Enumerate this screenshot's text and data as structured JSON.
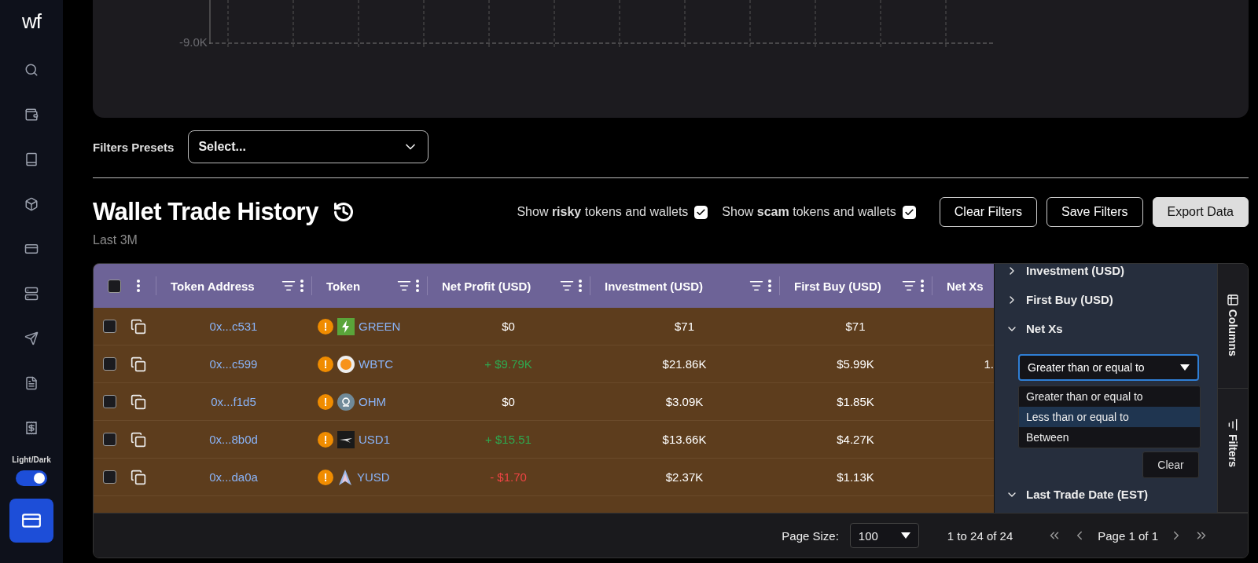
{
  "sidebar": {
    "logo": "wf",
    "items": [
      {
        "kind": "search",
        "selected": false
      },
      {
        "kind": "wallet",
        "selected": false
      },
      {
        "kind": "book",
        "selected": false
      },
      {
        "kind": "cube",
        "selected": false
      },
      {
        "kind": "card",
        "selected": false
      },
      {
        "kind": "server",
        "selected": false
      },
      {
        "kind": "send",
        "selected": false
      },
      {
        "kind": "file",
        "selected": false
      },
      {
        "kind": "receipt",
        "selected": false
      }
    ],
    "theme_toggle": {
      "label": "Light/Dark",
      "on": true
    },
    "bottom_item": {
      "kind": "card",
      "selected": true
    }
  },
  "chart": {
    "tick_label": "-9.0K"
  },
  "filters_presets": {
    "label": "Filters Presets",
    "placeholder": "Select..."
  },
  "header": {
    "title": "Wallet Trade History",
    "subtitle": "Last 3M"
  },
  "toggles": [
    {
      "label": "Show **risky** tokens and wallets",
      "checked": true
    },
    {
      "label": "Show **scam** tokens and wallets",
      "checked": true
    }
  ],
  "buttons": [
    {
      "label": "Clear Filters",
      "kind": "outline"
    },
    {
      "label": "Save Filters",
      "kind": "outline"
    },
    {
      "label": "Export Data",
      "kind": "solid"
    }
  ],
  "table": {
    "select_all": {
      "checked": false
    },
    "columns": [
      "Token Address",
      "Token",
      "Net Profit (USD)",
      "Investment (USD)",
      "First Buy (USD)",
      "Net Xs"
    ],
    "rows": [
      {
        "checked": false,
        "address": "0x...c531",
        "warning": "!",
        "token": {
          "name": "GREEN",
          "kind": "bolt"
        },
        "net_profit": {
          "value": "$0",
          "color": "#ffffff"
        },
        "investment": "$71",
        "first_buy": "$71"
      },
      {
        "checked": false,
        "address": "0x...c599",
        "warning": "!",
        "token": {
          "name": "WBTC",
          "kind": "coin"
        },
        "net_profit": {
          "value": "+ $9.79K",
          "color": "#2fa84f"
        },
        "investment": "$21.86K",
        "first_buy": "$5.99K",
        "net_xs": "1."
      },
      {
        "checked": false,
        "address": "0x...f1d5",
        "warning": "!",
        "token": {
          "name": "OHM",
          "kind": "omega"
        },
        "net_profit": {
          "value": "$0",
          "color": "#ffffff"
        },
        "investment": "$3.09K",
        "first_buy": "$1.85K"
      },
      {
        "checked": false,
        "address": "0x...8b0d",
        "warning": "!",
        "token": {
          "name": "USD1",
          "kind": "plane"
        },
        "net_profit": {
          "value": "+ $15.51",
          "color": "#2fa84f"
        },
        "investment": "$13.66K",
        "first_buy": "$4.27K"
      },
      {
        "checked": false,
        "address": "0x...da0a",
        "warning": "!",
        "token": {
          "name": "YUSD",
          "kind": "spire"
        },
        "net_profit": {
          "value": "- $1.70",
          "color": "#ef4444"
        },
        "investment": "$2.37K",
        "first_buy": "$1.13K"
      }
    ]
  },
  "filter_panel": {
    "items": [
      {
        "label": "Investment (USD)",
        "expanded": false
      },
      {
        "label": "First Buy (USD)",
        "expanded": false
      },
      {
        "label": "Net Xs",
        "expanded": true
      },
      {
        "label": "Last Trade Date (EST)",
        "expanded": true
      }
    ],
    "condition_select": {
      "value": "Greater than or equal to",
      "open": true,
      "options": [
        {
          "label": "Greater than or equal to",
          "highlighted": false
        },
        {
          "label": "Less than or equal to",
          "highlighted": true
        },
        {
          "label": "Between",
          "highlighted": false
        }
      ]
    },
    "clear_button": "Clear"
  },
  "side_tabs": [
    {
      "label": "Columns"
    },
    {
      "label": "Filters"
    }
  ],
  "pagination": {
    "page_size_label": "Page Size:",
    "page_size": "100",
    "range": "1 to 24 of 24",
    "page": "Page 1 of 1"
  }
}
